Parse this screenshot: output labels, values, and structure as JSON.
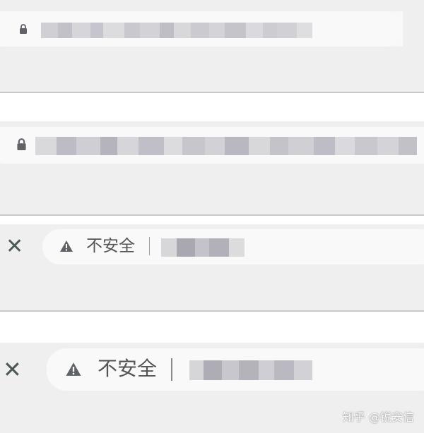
{
  "bars": [
    {
      "id": "secure-bar-1",
      "security_icon": "lock-icon",
      "url_text_visible": false
    },
    {
      "id": "secure-bar-2",
      "security_icon": "lock-icon",
      "url_text_visible": false
    },
    {
      "id": "insecure-bar-1",
      "left_button_icon": "close-icon",
      "security_icon": "warning-triangle-icon",
      "security_label": "不安全",
      "url_text_visible": false
    },
    {
      "id": "insecure-bar-2",
      "left_button_icon": "close-icon",
      "security_icon": "warning-triangle-icon",
      "security_label": "不安全",
      "url_text_visible": false
    }
  ],
  "watermark": {
    "text": "知乎 @锐安信"
  },
  "colors": {
    "toolbar_background": "#efefef",
    "omnibox_background": "#f9f9f9",
    "icon_gray": "#5f6368",
    "divider": "#c9c9c9"
  }
}
